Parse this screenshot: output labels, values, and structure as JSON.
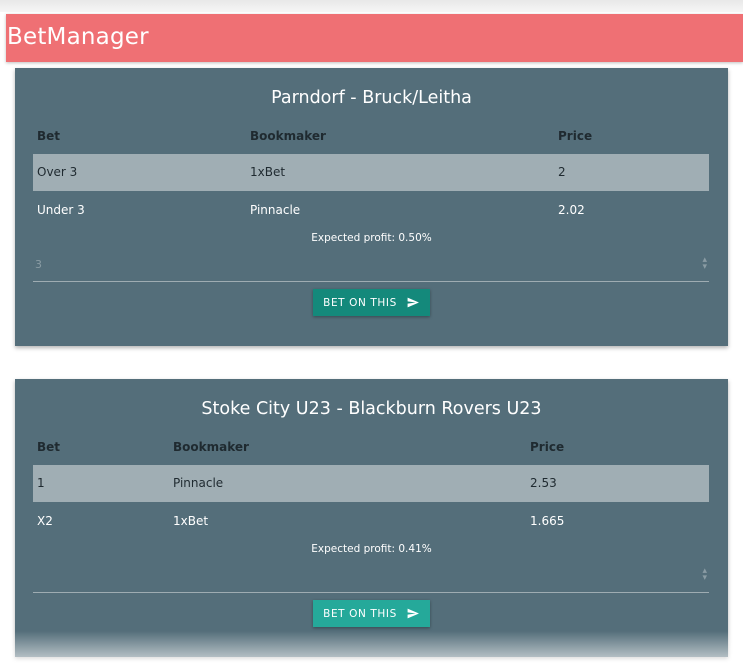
{
  "app": {
    "title": "BetManager"
  },
  "table_headers": {
    "bet": "Bet",
    "bookmaker": "Bookmaker",
    "price": "Price"
  },
  "bet_button": {
    "label": "BET ON THIS",
    "icon": "send-icon"
  },
  "cards": [
    {
      "match": "Parndorf - Bruck/Leitha",
      "rows": [
        {
          "bet": "Over 3",
          "bookmaker": "1xBet",
          "price": "2"
        },
        {
          "bet": "Under 3",
          "bookmaker": "Pinnacle",
          "price": "2.02"
        }
      ],
      "expected_profit": "Expected profit: 0.50%",
      "stake_value": "3"
    },
    {
      "match": "Stoke City U23 - Blackburn Rovers U23",
      "rows": [
        {
          "bet": "1",
          "bookmaker": "Pinnacle",
          "price": "2.53"
        },
        {
          "bet": "X2",
          "bookmaker": "1xBet",
          "price": "1.665"
        }
      ],
      "expected_profit": "Expected profit: 0.41%",
      "stake_value": ""
    }
  ],
  "colors": {
    "header": "#ef7074",
    "card": "#546e7a",
    "highlight_row": "#a0aeb4",
    "button": "#14897b",
    "button_hover": "#25a99a"
  }
}
